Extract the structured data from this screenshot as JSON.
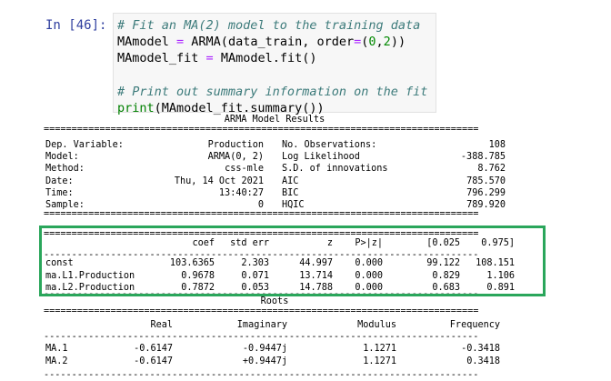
{
  "prompt": "In [46]:",
  "code": {
    "line1": "# Fit an MA(2) model to the training data",
    "line2_a": "MAmodel ",
    "line2_eq": "=",
    "line2_b": " ARMA(data_train, order",
    "line2_eq2": "=",
    "line2_c": "(",
    "line2_n0": "0",
    "line2_d": ",",
    "line2_n2": "2",
    "line2_e": "))",
    "line3_a": "MAmodel_fit ",
    "line3_eq": "=",
    "line3_b": " MAmodel.fit()",
    "line5": "# Print out summary information on the fit",
    "line6_builtin": "print",
    "line6_rest": "(MAmodel_fit.summary())"
  },
  "output": {
    "title": "ARMA Model Results",
    "rule_eq": "==============================================================================",
    "rule_dash": "------------------------------------------------------------------------------",
    "info_left": [
      {
        "label": "Dep. Variable:",
        "value": "Production"
      },
      {
        "label": "Model:",
        "value": "ARMA(0, 2)"
      },
      {
        "label": "Method:",
        "value": "css-mle"
      },
      {
        "label": "Date:",
        "value": "Thu, 14 Oct 2021"
      },
      {
        "label": "Time:",
        "value": "13:40:27"
      },
      {
        "label": "Sample:",
        "value": "0"
      }
    ],
    "info_right": [
      {
        "label": "No. Observations:",
        "value": "108"
      },
      {
        "label": "Log Likelihood",
        "value": "-388.785"
      },
      {
        "label": "S.D. of innovations",
        "value": "8.762"
      },
      {
        "label": "AIC",
        "value": "785.570"
      },
      {
        "label": "BIC",
        "value": "796.299"
      },
      {
        "label": "HQIC",
        "value": "789.920"
      }
    ],
    "coef_headers": [
      "coef",
      "std err",
      "z",
      "P>|z|",
      "[0.025",
      "0.975]"
    ],
    "coef_rows": [
      {
        "name": "const",
        "values": [
          "103.6365",
          "2.303",
          "44.997",
          "0.000",
          "99.122",
          "108.151"
        ]
      },
      {
        "name": "ma.L1.Production",
        "values": [
          "0.9678",
          "0.071",
          "13.714",
          "0.000",
          "0.829",
          "1.106"
        ]
      },
      {
        "name": "ma.L2.Production",
        "values": [
          "0.7872",
          "0.053",
          "14.788",
          "0.000",
          "0.683",
          "0.891"
        ]
      }
    ],
    "roots_title": "Roots",
    "roots_headers": [
      "Real",
      "Imaginary",
      "Modulus",
      "Frequency"
    ],
    "roots_rows": [
      {
        "name": "MA.1",
        "values": [
          "-0.6147",
          "-0.9447j",
          "1.1271",
          "-0.3418"
        ]
      },
      {
        "name": "MA.2",
        "values": [
          "-0.6147",
          "+0.9447j",
          "1.1271",
          "0.3418"
        ]
      }
    ]
  },
  "colors": {
    "highlight_border": "#2aa65b",
    "prompt": "#303f9f",
    "comment": "#3d7b7b"
  }
}
